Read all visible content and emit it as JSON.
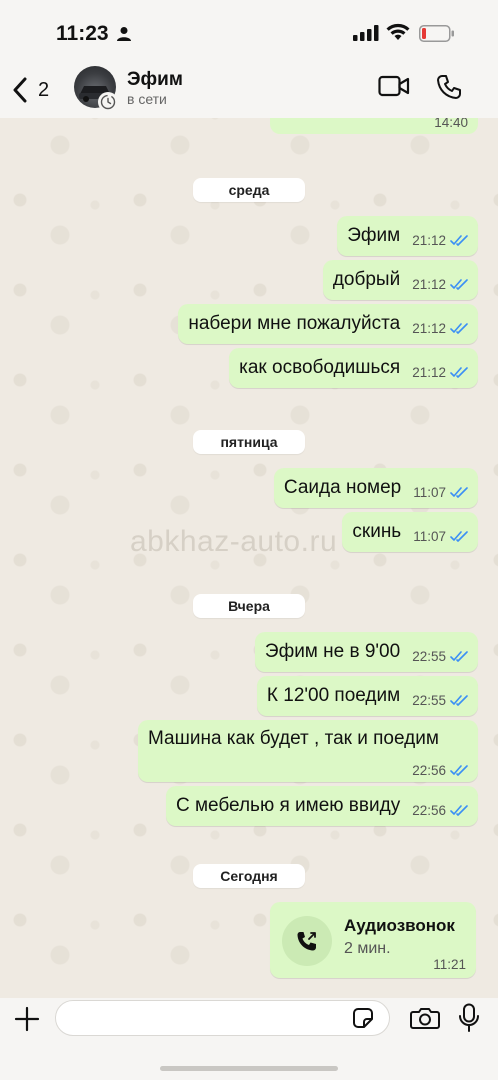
{
  "status_bar": {
    "time": "11:23"
  },
  "header": {
    "back_count": "2",
    "contact_name": "Эфим",
    "contact_status": "в сети"
  },
  "watermark": "abkhaz-auto.ru",
  "chat": {
    "previous_message_time": "14:40",
    "sections": [
      {
        "date": "среда",
        "messages": [
          {
            "text": "Эфим",
            "time": "21:12"
          },
          {
            "text": "добрый",
            "time": "21:12"
          },
          {
            "text": "набери мне пожалуйста",
            "time": "21:12"
          },
          {
            "text": "как освободишься",
            "time": "21:12"
          }
        ]
      },
      {
        "date": "пятница",
        "messages": [
          {
            "text": "Саида номер",
            "time": "11:07"
          },
          {
            "text": "скинь",
            "time": "11:07"
          }
        ]
      },
      {
        "date": "Вчера",
        "messages": [
          {
            "text": "Эфим не в 9'00",
            "time": "22:55"
          },
          {
            "text": "К 12'00 поедим",
            "time": "22:55"
          },
          {
            "text": "Машина как будет , так и поедим",
            "time": "22:56"
          },
          {
            "text": "С мебелью я имею ввиду",
            "time": "22:56"
          }
        ]
      },
      {
        "date": "Сегодня",
        "call": {
          "title": "Аудиозвонок",
          "duration": "2 мин.",
          "time": "11:21"
        }
      }
    ]
  },
  "input": {
    "placeholder": ""
  },
  "colors": {
    "outgoing_bubble": "#dcf8c6",
    "read_ticks": "#3b8ff5",
    "background": "#efeae2"
  }
}
